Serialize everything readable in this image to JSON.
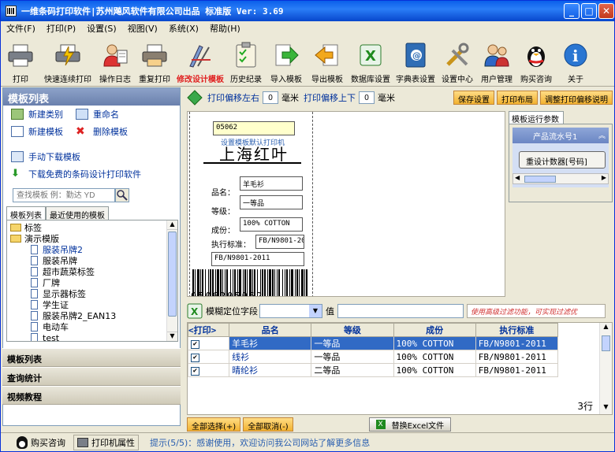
{
  "window": {
    "title": "一维条码打印软件|苏州飚风软件有限公司出品  标准版   Ver: 3.69"
  },
  "menu": [
    "文件(F)",
    "打印(P)",
    "设置(S)",
    "视图(V)",
    "系统(X)",
    "帮助(H)"
  ],
  "toolbar": [
    {
      "label": "打印",
      "icon": "printer-icon"
    },
    {
      "label": "快速连续打印",
      "icon": "fast-print-icon"
    },
    {
      "label": "操作日志",
      "icon": "log-users-icon"
    },
    {
      "label": "重复打印",
      "icon": "reprint-icon"
    },
    {
      "label": "修改设计模板",
      "icon": "design-template-icon",
      "highlight": true
    },
    {
      "label": "历史纪录",
      "icon": "history-clipboard-icon"
    },
    {
      "label": "导入模板",
      "icon": "import-arrow-icon"
    },
    {
      "label": "导出模板",
      "icon": "export-arrow-icon"
    },
    {
      "label": "数据库设置",
      "icon": "excel-db-icon"
    },
    {
      "label": "字典表设置",
      "icon": "dictionary-book-icon"
    },
    {
      "label": "设置中心",
      "icon": "tools-icon"
    },
    {
      "label": "用户管理",
      "icon": "users-icon"
    },
    {
      "label": "购买咨询",
      "icon": "penguin-icon"
    },
    {
      "label": "关于",
      "icon": "info-icon"
    }
  ],
  "sidebar": {
    "title": "模板列表",
    "actions": [
      "新建类别",
      "重命名",
      "新建模板",
      "删除模板"
    ],
    "links": [
      "手动下载模板",
      "下载免费的条码设计打印软件"
    ],
    "search_placeholder": "查找模板 例：勤达 YD",
    "tabs": [
      "模板列表",
      "最近使用的模板"
    ],
    "tree": [
      {
        "label": "标签",
        "level": 0,
        "type": "folder"
      },
      {
        "label": "演示模版",
        "level": 0,
        "type": "folder"
      },
      {
        "label": "服装吊牌2",
        "level": 1,
        "type": "doc",
        "highlight": true
      },
      {
        "label": "服装吊牌",
        "level": 1,
        "type": "doc"
      },
      {
        "label": "超市蔬菜标签",
        "level": 1,
        "type": "doc"
      },
      {
        "label": "厂牌",
        "level": 1,
        "type": "doc"
      },
      {
        "label": "显示器标签",
        "level": 1,
        "type": "doc"
      },
      {
        "label": "学生证",
        "level": 1,
        "type": "doc"
      },
      {
        "label": "服装吊牌2_EAN13",
        "level": 1,
        "type": "doc"
      },
      {
        "label": "电动车",
        "level": 1,
        "type": "doc"
      },
      {
        "label": "test",
        "level": 1,
        "type": "doc"
      }
    ],
    "sections": [
      "模板列表",
      "查询统计",
      "视频教程"
    ]
  },
  "offset": {
    "lr_label": "打印偏移左右",
    "lr_value": "0",
    "unit1": "毫米",
    "ud_label": "打印偏移上下",
    "ud_value": "0",
    "unit2": "毫米",
    "buttons": [
      "保存设置",
      "打印布局",
      "调整打印偏移说明"
    ]
  },
  "label_preview": {
    "code": "05062",
    "link": "设置模板默认打印机",
    "title": "上海红叶",
    "fields": [
      {
        "name": "品名：",
        "value": "羊毛衫"
      },
      {
        "name": "等级：",
        "value": "一等品"
      },
      {
        "name": "成份：",
        "value": "100% COTTON"
      },
      {
        "name": "执行标准：",
        "value": "FB/N9801-20"
      }
    ],
    "extra_value": "FB/N9801-2011",
    "barcode_digits": "0506205062"
  },
  "params": {
    "tab": "模板运行参数",
    "serial_label": "产品流水号1",
    "reset_button": "重设计数器[号码]"
  },
  "filter": {
    "label": "模糊定位字段",
    "value_label": "值",
    "hint": "使用高级过滤功能，可实现过滤优"
  },
  "grid": {
    "columns": [
      "<打印>",
      "品名",
      "等级",
      "成份",
      "执行标准"
    ],
    "rows": [
      {
        "checked": true,
        "name": "羊毛衫",
        "grade": "一等品",
        "composition": "100% COTTON",
        "standard": "FB/N9801-2011",
        "selected": true
      },
      {
        "checked": true,
        "name": "线衫",
        "grade": "一等品",
        "composition": "100% COTTON",
        "standard": "FB/N9801-2011",
        "selected": false
      },
      {
        "checked": true,
        "name": "晴纶衫",
        "grade": "二等品",
        "composition": "100% COTTON",
        "standard": "FB/N9801-2011",
        "selected": false
      }
    ],
    "row_count": "3行"
  },
  "bottom": {
    "select_all": "全部选择(+)",
    "deselect_all": "全部取消(-)",
    "replace_excel": "替换Excel文件"
  },
  "status": {
    "buy": "购买咨询",
    "printer": "打印机属性",
    "tip": "提示(5/5)：感谢使用，欢迎访问我公司网站了解更多信息"
  },
  "colors": {
    "title_blue": "#0a5fea",
    "accent_orange": "#f2b230",
    "select_blue": "#316ac5",
    "design_red": "#e02020"
  }
}
